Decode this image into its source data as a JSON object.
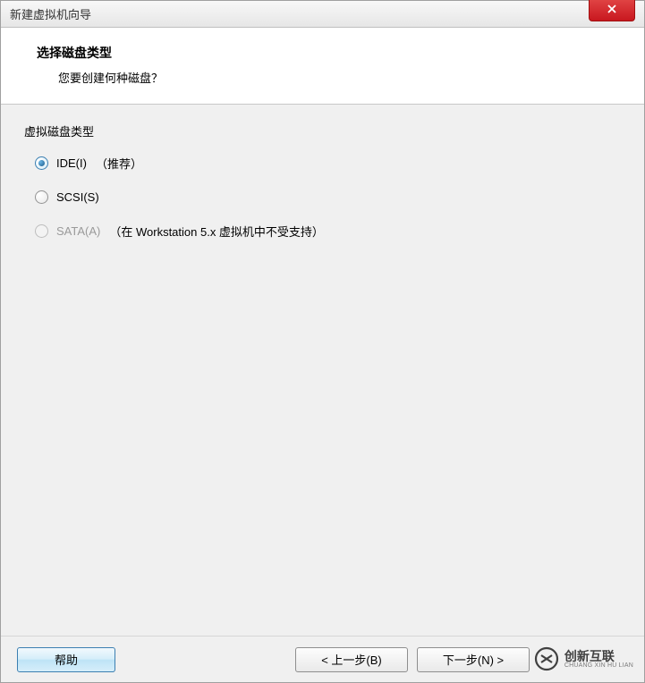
{
  "window": {
    "title": "新建虚拟机向导"
  },
  "header": {
    "title": "选择磁盘类型",
    "subtitle": "您要创建何种磁盘？"
  },
  "section": {
    "label": "虚拟磁盘类型"
  },
  "options": {
    "ide": {
      "label": "IDE(I)",
      "note": "（推荐）",
      "checked": true,
      "disabled": false
    },
    "scsi": {
      "label": "SCSI(S)",
      "note": "",
      "checked": false,
      "disabled": false
    },
    "sata": {
      "label": "SATA(A)",
      "note": "（在 Workstation 5.x 虚拟机中不受支持）",
      "checked": false,
      "disabled": true
    }
  },
  "buttons": {
    "help": "帮助",
    "back": "< 上一步(B)",
    "next": "下一步(N) >"
  },
  "watermark": {
    "cn": "创新互联",
    "en": "CHUANG XIN HU LIAN"
  }
}
